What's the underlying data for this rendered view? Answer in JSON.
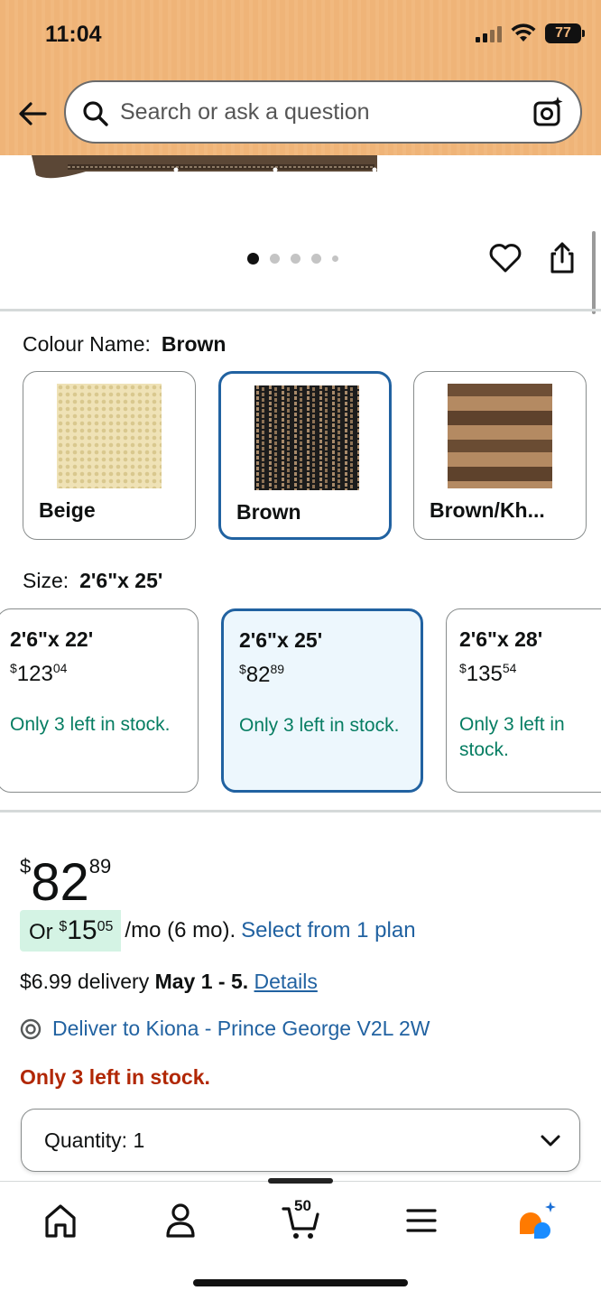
{
  "status_bar": {
    "time": "11:04",
    "battery": "77"
  },
  "search": {
    "placeholder": "Search or ask a question"
  },
  "carousel": {
    "pages": 5,
    "active_index": 0
  },
  "colour": {
    "label": "Colour Name:",
    "selected": "Brown",
    "options": [
      {
        "name": "Beige"
      },
      {
        "name": "Brown"
      },
      {
        "name": "Brown/Kh..."
      }
    ]
  },
  "size": {
    "label": "Size:",
    "selected": "2'6\"x 25'",
    "options": [
      {
        "dim": "2'6\"x 22'",
        "currency": "$",
        "dollars": "123",
        "cents": "04",
        "stock": "Only 3 left in stock."
      },
      {
        "dim": "2'6\"x 25'",
        "currency": "$",
        "dollars": "82",
        "cents": "89",
        "stock": "Only 3 left in stock."
      },
      {
        "dim": "2'6\"x 28'",
        "currency": "$",
        "dollars": "135",
        "cents": "54",
        "stock": "Only 3 left in stock."
      }
    ]
  },
  "price": {
    "currency": "$",
    "dollars": "82",
    "cents": "89"
  },
  "plan": {
    "prefix": "Or",
    "currency": "$",
    "dollars": "15",
    "cents": "05",
    "suffix": "/mo (6 mo).",
    "link": "Select from 1 plan"
  },
  "delivery": {
    "text": "$6.99 delivery",
    "date": "May 1 - 5.",
    "link": "Details"
  },
  "deliver_to": "Deliver to Kiona - Prince George V2L 2W",
  "stock_alert": "Only 3 left in stock.",
  "quantity": {
    "label": "Quantity:",
    "value": "1"
  },
  "nav": {
    "cart_count": "50"
  },
  "colors": {
    "header": "#efb478",
    "link": "#2162a1",
    "in_stock_green": "#067d62",
    "alert_red": "#b12704",
    "selected_border": "#2162a1"
  }
}
